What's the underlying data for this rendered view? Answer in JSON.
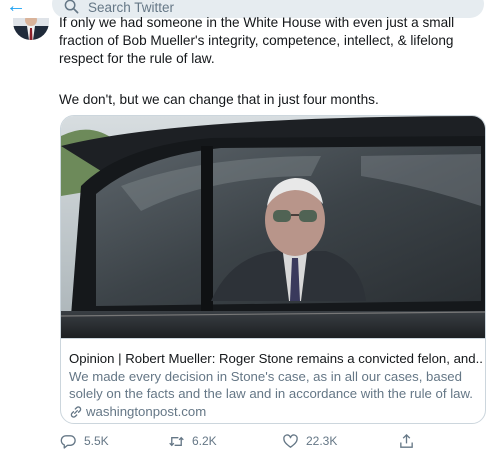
{
  "header": {
    "back_icon": "back-arrow-icon",
    "search_placeholder": "Search Twitter"
  },
  "tweet": {
    "text_line1": "If only we had someone in the White House with even just a small fraction of Bob Mueller's integrity, competence, intellect, & lifelong respect for the rule of law.",
    "text_line2": "We don't, but we can change that in just four months."
  },
  "card": {
    "title": "Opinion | Robert Mueller: Roger Stone remains a convicted felon, and...",
    "description": "We made every decision in Stone's case, as in all our cases, based solely on the facts and the law and in accordance with the rule of law.",
    "domain": "washingtonpost.com"
  },
  "actions": {
    "replies": "5.5K",
    "retweets": "6.2K",
    "likes": "22.3K"
  },
  "colors": {
    "accent": "#1da1f2",
    "muted": "#657786",
    "border": "#ccd6dd"
  }
}
